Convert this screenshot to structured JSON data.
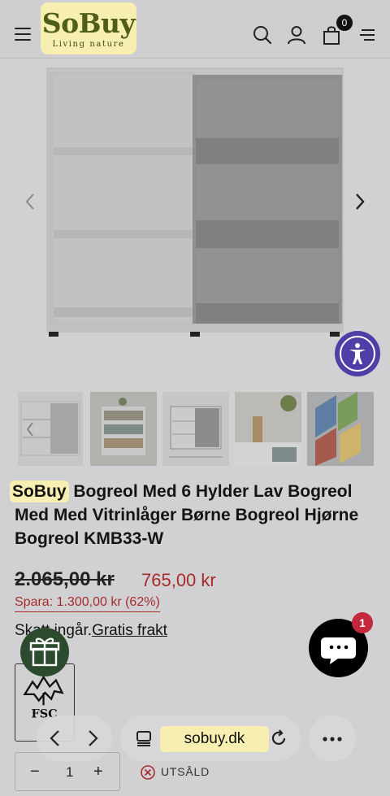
{
  "header": {
    "logo_text": "SoBuy",
    "logo_tagline": "Living nature",
    "cart_count": "0"
  },
  "gallery": {
    "thumbnail_count": 5
  },
  "product": {
    "brand": "SoBuy",
    "title_rest": " Bogreol Med 6 Hylder Lav Bogreol Med Med Vitrinlåger Børne Bogreol Hjørne Bogreol KMB33-W",
    "old_price": "2.065,00 kr",
    "new_price": "765,00 kr",
    "savings": "Spara: 1.300,00 kr (62%)",
    "shipping_prefix": "Skatt ingår.",
    "shipping_link": "Gratis frakt",
    "certification_label": "FSC",
    "quantity": "1",
    "quantity_minus": "−",
    "quantity_plus": "+",
    "stock_status": "UTSÅLD"
  },
  "chat": {
    "badge_count": "1"
  },
  "browser": {
    "url": "sobuy.dk"
  },
  "colors": {
    "accent_red": "#a82b2b",
    "highlight_yellow": "#f7efb1",
    "brand_green": "#4e5e17",
    "gift_green": "#2c4a2d",
    "accessibility_purple": "#4e3fa7",
    "chat_badge_red": "#c4283c"
  },
  "icons": [
    "menu-icon",
    "search-icon",
    "account-icon",
    "cart-icon",
    "drawer-icon",
    "chevron-left-icon",
    "chevron-right-icon",
    "accessibility-icon",
    "gift-icon",
    "chat-icon",
    "fsc-tree-icon",
    "back-icon",
    "forward-icon",
    "tabs-icon",
    "reload-icon",
    "more-icon",
    "close-circle-icon"
  ]
}
